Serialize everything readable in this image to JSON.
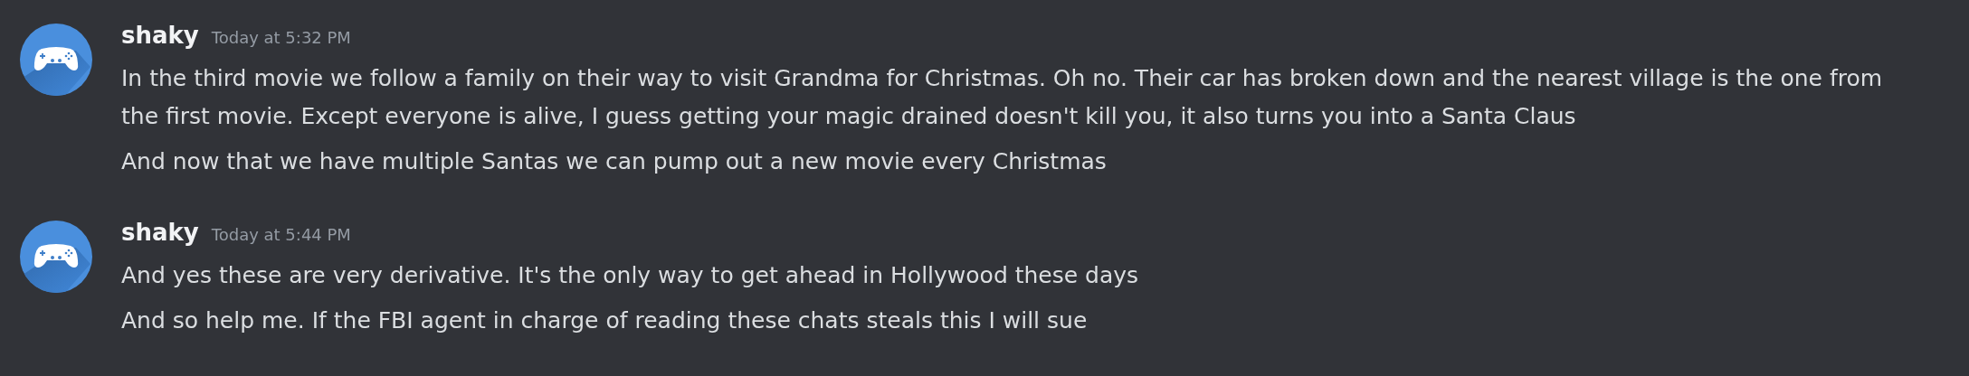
{
  "messages": [
    {
      "author": "shaky",
      "timestamp": "Today at 5:32 PM",
      "lines": [
        "In the third movie we follow a family on their way to visit Grandma for Christmas. Oh no. Their car has broken down and the nearest village is the one from the first movie. Except everyone is alive, I guess getting your magic drained doesn't kill you, it also turns you into a Santa Claus",
        "And now that we have multiple Santas we can pump out a new movie every Christmas"
      ]
    },
    {
      "author": "shaky",
      "timestamp": "Today at 5:44 PM",
      "lines": [
        "And yes these are very derivative. It's the only way to get ahead in Hollywood these days",
        "And so help me. If the FBI agent in charge of reading these chats steals this I will sue"
      ]
    }
  ]
}
